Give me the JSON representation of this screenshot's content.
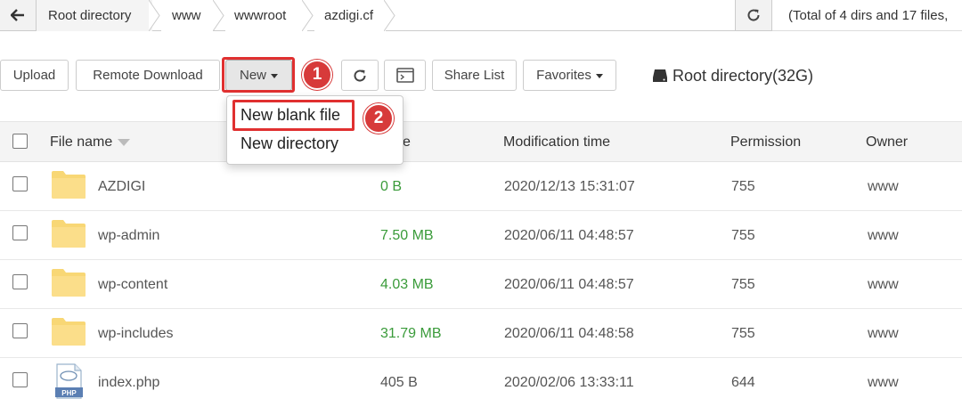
{
  "breadcrumb": {
    "items": [
      "Root directory",
      "www",
      "wwwroot",
      "azdigi.cf"
    ],
    "total": "(Total of 4 dirs and 17 files,"
  },
  "toolbar": {
    "upload": "Upload",
    "remote_download": "Remote Download",
    "new": "New",
    "share_list": "Share List",
    "favorites": "Favorites",
    "disk": "Root directory(32G)"
  },
  "dropdown": {
    "items": [
      "New blank file",
      "New directory"
    ]
  },
  "annotations": {
    "step1": "1",
    "step2": "2",
    "highlight_color": "#e03030"
  },
  "table": {
    "headers": {
      "name": "File name",
      "size": "e",
      "mtime": "Modification time",
      "permission": "Permission",
      "owner": "Owner"
    },
    "rows": [
      {
        "name": "AZDIGI",
        "type": "folder",
        "size": "0 B",
        "mtime": "2020/12/13 15:31:07",
        "perm": "755",
        "owner": "www"
      },
      {
        "name": "wp-admin",
        "type": "folder",
        "size": "7.50 MB",
        "mtime": "2020/06/11 04:48:57",
        "perm": "755",
        "owner": "www"
      },
      {
        "name": "wp-content",
        "type": "folder",
        "size": "4.03 MB",
        "mtime": "2020/06/11 04:48:57",
        "perm": "755",
        "owner": "www"
      },
      {
        "name": "wp-includes",
        "type": "folder",
        "size": "31.79 MB",
        "mtime": "2020/06/11 04:48:58",
        "perm": "755",
        "owner": "www"
      },
      {
        "name": "index.php",
        "type": "php",
        "size": "405 B",
        "mtime": "2020/02/06 13:33:11",
        "perm": "644",
        "owner": "www"
      }
    ]
  },
  "colors": {
    "size_green": "#3a9b3a",
    "folder": "#f8d775"
  }
}
